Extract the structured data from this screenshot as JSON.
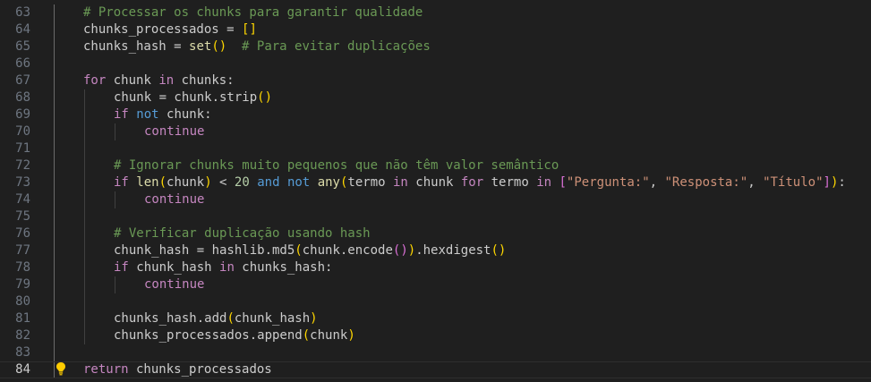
{
  "editor": {
    "active_line": 84,
    "lines": [
      {
        "n": 63,
        "indent": 1,
        "tokens": [
          {
            "c": "cm",
            "t": "# Processar os chunks para garantir qualidade"
          }
        ]
      },
      {
        "n": 64,
        "indent": 1,
        "tokens": [
          {
            "c": "tx",
            "t": "chunks_processados = "
          },
          {
            "c": "p1",
            "t": "[]"
          }
        ]
      },
      {
        "n": 65,
        "indent": 1,
        "tokens": [
          {
            "c": "tx",
            "t": "chunks_hash = "
          },
          {
            "c": "fn",
            "t": "set"
          },
          {
            "c": "p1",
            "t": "()"
          },
          {
            "c": "tx",
            "t": "  "
          },
          {
            "c": "cm",
            "t": "# Para evitar duplicações"
          }
        ]
      },
      {
        "n": 66,
        "indent": 0,
        "tokens": []
      },
      {
        "n": 67,
        "indent": 1,
        "tokens": [
          {
            "c": "kw",
            "t": "for"
          },
          {
            "c": "tx",
            "t": " chunk "
          },
          {
            "c": "kw",
            "t": "in"
          },
          {
            "c": "tx",
            "t": " chunks:"
          }
        ]
      },
      {
        "n": 68,
        "indent": 2,
        "tokens": [
          {
            "c": "tx",
            "t": "chunk = chunk.strip"
          },
          {
            "c": "p1",
            "t": "()"
          }
        ]
      },
      {
        "n": 69,
        "indent": 2,
        "tokens": [
          {
            "c": "kw",
            "t": "if"
          },
          {
            "c": "tx",
            "t": " "
          },
          {
            "c": "op",
            "t": "not"
          },
          {
            "c": "tx",
            "t": " chunk:"
          }
        ]
      },
      {
        "n": 70,
        "indent": 3,
        "tokens": [
          {
            "c": "kw",
            "t": "continue"
          }
        ]
      },
      {
        "n": 71,
        "indent": 0,
        "tokens": []
      },
      {
        "n": 72,
        "indent": 2,
        "tokens": [
          {
            "c": "cm",
            "t": "# Ignorar chunks muito pequenos que não têm valor semântico"
          }
        ]
      },
      {
        "n": 73,
        "indent": 2,
        "tokens": [
          {
            "c": "kw",
            "t": "if"
          },
          {
            "c": "tx",
            "t": " "
          },
          {
            "c": "fn",
            "t": "len"
          },
          {
            "c": "p1",
            "t": "("
          },
          {
            "c": "tx",
            "t": "chunk"
          },
          {
            "c": "p1",
            "t": ")"
          },
          {
            "c": "tx",
            "t": " < "
          },
          {
            "c": "nu",
            "t": "20"
          },
          {
            "c": "tx",
            "t": " "
          },
          {
            "c": "op",
            "t": "and"
          },
          {
            "c": "tx",
            "t": " "
          },
          {
            "c": "op",
            "t": "not"
          },
          {
            "c": "tx",
            "t": " "
          },
          {
            "c": "fn",
            "t": "any"
          },
          {
            "c": "p1",
            "t": "("
          },
          {
            "c": "tx",
            "t": "termo "
          },
          {
            "c": "kw",
            "t": "in"
          },
          {
            "c": "tx",
            "t": " chunk "
          },
          {
            "c": "kw",
            "t": "for"
          },
          {
            "c": "tx",
            "t": " termo "
          },
          {
            "c": "kw",
            "t": "in"
          },
          {
            "c": "tx",
            "t": " "
          },
          {
            "c": "p2",
            "t": "["
          },
          {
            "c": "st",
            "t": "\"Pergunta:\""
          },
          {
            "c": "tx",
            "t": ", "
          },
          {
            "c": "st",
            "t": "\"Resposta:\""
          },
          {
            "c": "tx",
            "t": ", "
          },
          {
            "c": "st",
            "t": "\"Título\""
          },
          {
            "c": "p2",
            "t": "]"
          },
          {
            "c": "p1",
            "t": ")"
          },
          {
            "c": "tx",
            "t": ":"
          }
        ]
      },
      {
        "n": 74,
        "indent": 3,
        "tokens": [
          {
            "c": "kw",
            "t": "continue"
          }
        ]
      },
      {
        "n": 75,
        "indent": 0,
        "tokens": []
      },
      {
        "n": 76,
        "indent": 2,
        "tokens": [
          {
            "c": "cm",
            "t": "# Verificar duplicação usando hash"
          }
        ]
      },
      {
        "n": 77,
        "indent": 2,
        "tokens": [
          {
            "c": "tx",
            "t": "chunk_hash = hashlib.md5"
          },
          {
            "c": "p1",
            "t": "("
          },
          {
            "c": "tx",
            "t": "chunk.encode"
          },
          {
            "c": "p2",
            "t": "()"
          },
          {
            "c": "p1",
            "t": ")"
          },
          {
            "c": "tx",
            "t": ".hexdigest"
          },
          {
            "c": "p1",
            "t": "()"
          }
        ]
      },
      {
        "n": 78,
        "indent": 2,
        "tokens": [
          {
            "c": "kw",
            "t": "if"
          },
          {
            "c": "tx",
            "t": " chunk_hash "
          },
          {
            "c": "kw",
            "t": "in"
          },
          {
            "c": "tx",
            "t": " chunks_hash:"
          }
        ]
      },
      {
        "n": 79,
        "indent": 3,
        "tokens": [
          {
            "c": "kw",
            "t": "continue"
          }
        ]
      },
      {
        "n": 80,
        "indent": 0,
        "tokens": []
      },
      {
        "n": 81,
        "indent": 2,
        "tokens": [
          {
            "c": "tx",
            "t": "chunks_hash.add"
          },
          {
            "c": "p1",
            "t": "("
          },
          {
            "c": "tx",
            "t": "chunk_hash"
          },
          {
            "c": "p1",
            "t": ")"
          }
        ]
      },
      {
        "n": 82,
        "indent": 2,
        "tokens": [
          {
            "c": "tx",
            "t": "chunks_processados.append"
          },
          {
            "c": "p1",
            "t": "("
          },
          {
            "c": "tx",
            "t": "chunk"
          },
          {
            "c": "p1",
            "t": ")"
          }
        ]
      },
      {
        "n": 83,
        "indent": 0,
        "tokens": []
      },
      {
        "n": 84,
        "indent": 1,
        "tokens": [
          {
            "c": "kw",
            "t": "return"
          },
          {
            "c": "tx",
            "t": " chunks_processados"
          }
        ]
      }
    ],
    "lightbulb_icon": "lightbulb-icon",
    "colors": {
      "background": "#1f1f1f",
      "comment": "#6a9955",
      "keyword": "#c586c0",
      "operator_keyword": "#569cd6",
      "function": "#dcdcaa",
      "string": "#ce9178",
      "number": "#b5cea8",
      "bracket_level1": "#ffd700",
      "bracket_level2": "#da70d6",
      "lightbulb": "#ffcc00"
    }
  }
}
